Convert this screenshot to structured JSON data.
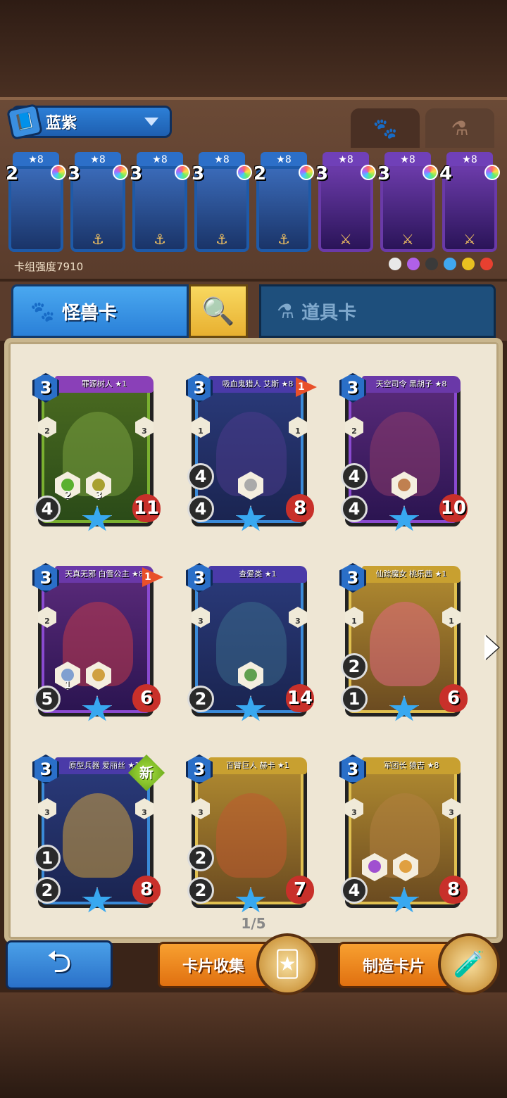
{
  "deck": {
    "name": "蓝紫",
    "strength_label": "卡组强度7910",
    "cards": [
      {
        "cost": "2",
        "stars": "★8",
        "color": "blue",
        "weapon": "none"
      },
      {
        "cost": "3",
        "stars": "★8",
        "color": "blue",
        "weapon": "hook"
      },
      {
        "cost": "3",
        "stars": "★8",
        "color": "blue",
        "weapon": "hook"
      },
      {
        "cost": "3",
        "stars": "★8",
        "color": "blue",
        "weapon": "hook"
      },
      {
        "cost": "2",
        "stars": "★8",
        "color": "blue",
        "weapon": "hook"
      },
      {
        "cost": "3",
        "stars": "★8",
        "color": "purple",
        "weapon": "sword"
      },
      {
        "cost": "3",
        "stars": "★8",
        "color": "purple",
        "weapon": "sword-hook"
      },
      {
        "cost": "4",
        "stars": "★8",
        "color": "purple",
        "weapon": "sword"
      }
    ],
    "faction_icons": [
      "#e8e8e8",
      "#b060e8",
      "#3a3a3a",
      "#40a8f0",
      "#e8c020",
      "#e84030"
    ]
  },
  "top_tabs": {
    "active_icon": "paw-icon",
    "inactive_icon": "potion-icon"
  },
  "tabs": {
    "monster_label": "怪兽卡",
    "items_label": "道具卡"
  },
  "cards": [
    {
      "name": "罪源树人 ★1",
      "cost": "3",
      "atk": "4",
      "spd": "4",
      "hp": "11",
      "frame": "green",
      "art": "#7aa040",
      "flag": "",
      "new": "",
      "side_left": "2",
      "side_right": "3",
      "abilities": [
        {
          "color": "#5ab030",
          "value": "2"
        },
        {
          "color": "#a8a030",
          "value": "3"
        }
      ],
      "show_atk": false
    },
    {
      "name": "吸血鬼猎人 艾斯 ★8",
      "cost": "3",
      "atk": "4",
      "spd": "4",
      "hp": "8",
      "frame": "blue",
      "art": "#4a3a8a",
      "flag": "1",
      "new": "",
      "side_left": "1",
      "side_right": "1",
      "abilities": [
        {
          "color": "#aaaaaa",
          "value": ""
        }
      ],
      "show_atk": true
    },
    {
      "name": "天空司令 黑胡子 ★8",
      "cost": "3",
      "atk": "4",
      "spd": "4",
      "hp": "10",
      "frame": "purple",
      "art": "#8a3a6a",
      "flag": "",
      "new": "",
      "side_left": "2",
      "side_right": "",
      "abilities": [
        {
          "color": "#c08050",
          "value": ""
        }
      ],
      "show_atk": true
    },
    {
      "name": "天真无邪 白雪公主 ★8",
      "cost": "3",
      "atk": "5",
      "spd": "5",
      "hp": "6",
      "frame": "purple",
      "art": "#c03a4a",
      "flag": "1",
      "new": "",
      "side_left": "2",
      "side_right": "",
      "abilities": [
        {
          "color": "#80a0d0",
          "value": "1"
        },
        {
          "color": "#d0a040",
          "value": ""
        }
      ],
      "show_atk": false
    },
    {
      "name": "查爱类 ★1",
      "cost": "3",
      "atk": "2",
      "spd": "2",
      "hp": "14",
      "frame": "blue",
      "art": "#3a6a8a",
      "flag": "",
      "new": "",
      "side_left": "3",
      "side_right": "3",
      "abilities": [
        {
          "color": "#60a050",
          "value": ""
        }
      ],
      "show_atk": false
    },
    {
      "name": "仙踪魔女 桃乐茜 ★1",
      "cost": "3",
      "atk": "2",
      "spd": "1",
      "hp": "6",
      "frame": "gold",
      "art": "#e06a80",
      "flag": "",
      "new": "",
      "side_left": "1",
      "side_right": "1",
      "abilities": [],
      "show_atk": true
    },
    {
      "name": "原型兵器 爱丽丝 ★1",
      "cost": "3",
      "atk": "1",
      "spd": "2",
      "hp": "8",
      "frame": "blue",
      "art": "#d0a040",
      "flag": "",
      "new": "新",
      "side_left": "3",
      "side_right": "3",
      "abilities": [],
      "show_atk": true
    },
    {
      "name": "百臂巨人 赫卡 ★1",
      "cost": "3",
      "atk": "2",
      "spd": "2",
      "hp": "7",
      "frame": "gold",
      "art": "#c05a30",
      "flag": "",
      "new": "",
      "side_left": "3",
      "side_right": "",
      "abilities": [],
      "show_atk": true
    },
    {
      "name": "军团长 猿吉 ★8",
      "cost": "3",
      "atk": "4",
      "spd": "4",
      "hp": "8",
      "frame": "gold",
      "art": "#b08040",
      "flag": "",
      "new": "",
      "side_left": "3",
      "side_right": "3",
      "abilities": [
        {
          "color": "#a050d0",
          "value": ""
        },
        {
          "color": "#e0a040",
          "value": ""
        }
      ],
      "show_atk": false
    }
  ],
  "pagination": "1/5",
  "buttons": {
    "back_icon": "back-arrow-icon",
    "collect_label": "卡片收集",
    "craft_label": "制造卡片"
  }
}
